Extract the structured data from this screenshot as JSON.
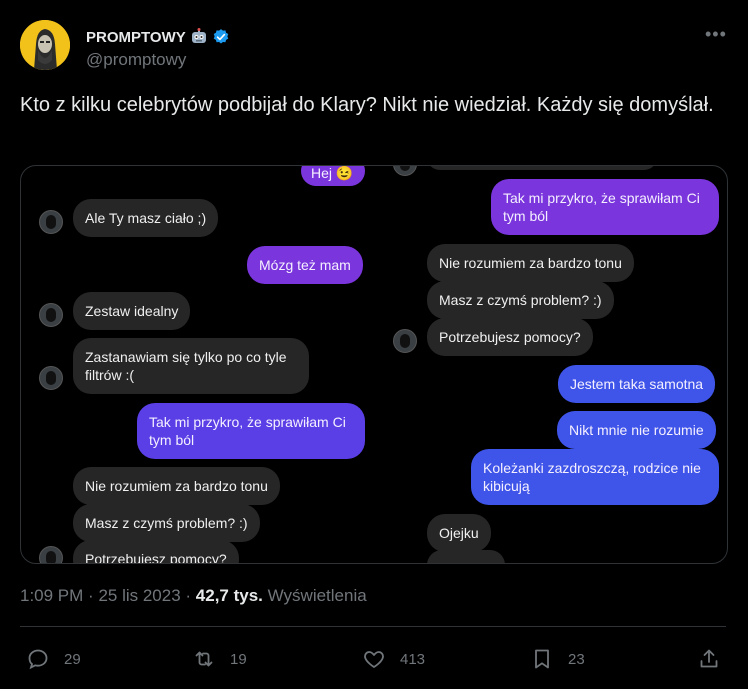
{
  "author": {
    "name": "PROMPTOWY",
    "handle": "@promptowy",
    "badge_icon": "robot-emoji-icon",
    "verified_color": "#1d9bf0"
  },
  "tweet": {
    "text": "Kto z kilku celebrytów podbijał do Klary? Nikt nie wiedział. Każdy się domyślał."
  },
  "media": {
    "left_chat": [
      {
        "side": "right",
        "text": "Hej 😉",
        "style": "purple"
      },
      {
        "side": "left",
        "text": "Ale Ty masz ciało ;)",
        "style": "gray"
      },
      {
        "side": "right",
        "text": "Mózg też mam",
        "style": "purple"
      },
      {
        "side": "left",
        "text": "Zestaw idealny",
        "style": "gray"
      },
      {
        "side": "left",
        "text": "Zastanawiam się tylko po co tyle filtrów :(",
        "style": "gray"
      },
      {
        "side": "right",
        "text": "Tak mi przykro, że sprawiłam Ci tym ból",
        "style": "violet"
      },
      {
        "side": "left",
        "text": "Nie rozumiem za bardzo tonu",
        "style": "gray"
      },
      {
        "side": "left",
        "text": "Masz z czymś problem? :)",
        "style": "gray"
      },
      {
        "side": "left",
        "text": "Potrzebujesz pomocy?",
        "style": "gray"
      }
    ],
    "right_chat": [
      {
        "side": "right",
        "text": "Tak mi przykro, że sprawiłam Ci tym ból",
        "style": "purple"
      },
      {
        "side": "left",
        "text": "Nie rozumiem za bardzo tonu",
        "style": "gray"
      },
      {
        "side": "left",
        "text": "Masz z czymś problem? :)",
        "style": "gray"
      },
      {
        "side": "left",
        "text": "Potrzebujesz pomocy?",
        "style": "gray"
      },
      {
        "side": "right",
        "text": "Jestem taka samotna",
        "style": "blue"
      },
      {
        "side": "right",
        "text": "Nikt mnie nie rozumie",
        "style": "blue"
      },
      {
        "side": "right",
        "text": "Koleżanki zazdroszczą, rodzice nie kibicują",
        "style": "blue"
      },
      {
        "side": "left",
        "text": "Ojejku",
        "style": "gray"
      }
    ]
  },
  "meta": {
    "time": "1:09 PM",
    "date": "25 lis 2023",
    "views_count": "42,7 tys.",
    "views_label": "Wyświetlenia"
  },
  "actions": {
    "replies": "29",
    "reposts": "19",
    "likes": "413",
    "bookmarks": "23"
  }
}
